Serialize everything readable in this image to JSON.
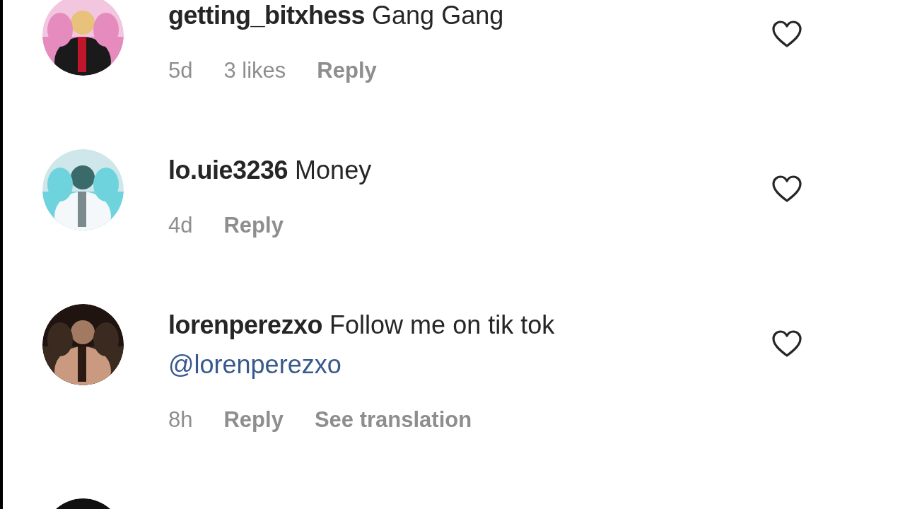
{
  "comments": [
    {
      "avatar": {
        "kind": "picture"
      },
      "username": "getting_bitxhess",
      "text": "Gang Gang",
      "liked": false,
      "meta": [
        {
          "kind": "time",
          "label": "5d"
        },
        {
          "kind": "likes",
          "label": "3 likes"
        },
        {
          "kind": "action",
          "label": "Reply"
        }
      ]
    },
    {
      "avatar": {
        "kind": "picture"
      },
      "username": "lo.uie3236",
      "text": "Money",
      "liked": false,
      "meta": [
        {
          "kind": "time",
          "label": "4d"
        },
        {
          "kind": "action",
          "label": "Reply"
        }
      ]
    },
    {
      "avatar": {
        "kind": "picture"
      },
      "username": "lorenperezxo",
      "text": "Follow me on tik tok",
      "mention": "@lorenperezxo",
      "liked": false,
      "meta": [
        {
          "kind": "time",
          "label": "8h"
        },
        {
          "kind": "action",
          "label": "Reply"
        },
        {
          "kind": "action",
          "label": "See translation"
        }
      ]
    },
    {
      "avatar": {
        "kind": "picture"
      }
    }
  ]
}
